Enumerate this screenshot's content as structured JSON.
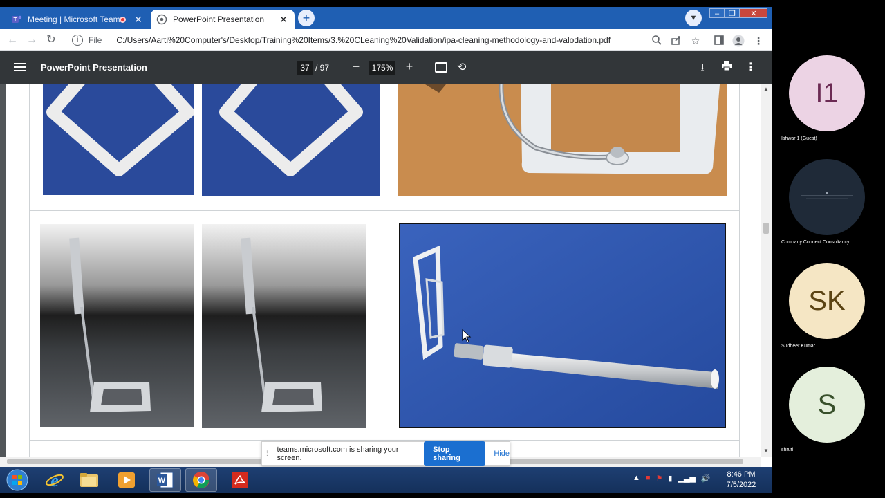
{
  "tabs": [
    {
      "title": "Meeting | Microsoft Teams",
      "recording": true
    },
    {
      "title": "PowerPoint Presentation"
    }
  ],
  "address": {
    "scheme_label": "File",
    "url": "C:/Users/Aarti%20Computer's/Desktop/Training%20Items/3.%20CLeaning%20Validation/ipa-cleaning-methodology-and-valodation.pdf"
  },
  "pdf": {
    "title": "PowerPoint Presentation",
    "current_page": "37",
    "total_pages": "/ 97",
    "zoom": "175%"
  },
  "share_banner": {
    "message": "teams.microsoft.com is sharing your screen.",
    "stop_label": "Stop sharing",
    "hide_label": "Hide"
  },
  "clock": {
    "time": "8:46 PM",
    "date": "7/5/2022"
  },
  "participants": [
    {
      "initials": "I1",
      "name": "Ishwar 1 (Guest)",
      "bg": "#ecd3e4",
      "fg": "#6b2a53"
    },
    {
      "initials": "",
      "name": "Company Connect Consultancy",
      "bg": "#1f2a38",
      "fg": "#cfd6df"
    },
    {
      "initials": "SK",
      "name": "Sudheer Kumar",
      "bg": "#f5e6c4",
      "fg": "#5b4414"
    },
    {
      "initials": "S",
      "name": "shruti",
      "bg": "#e4efdc",
      "fg": "#38502b"
    }
  ],
  "colors": {
    "tabbar": "#1f5fb3",
    "pdf_toolbar": "#323639",
    "photo_blue": "#2a4a9b",
    "stop_button": "#1b6fd0"
  }
}
